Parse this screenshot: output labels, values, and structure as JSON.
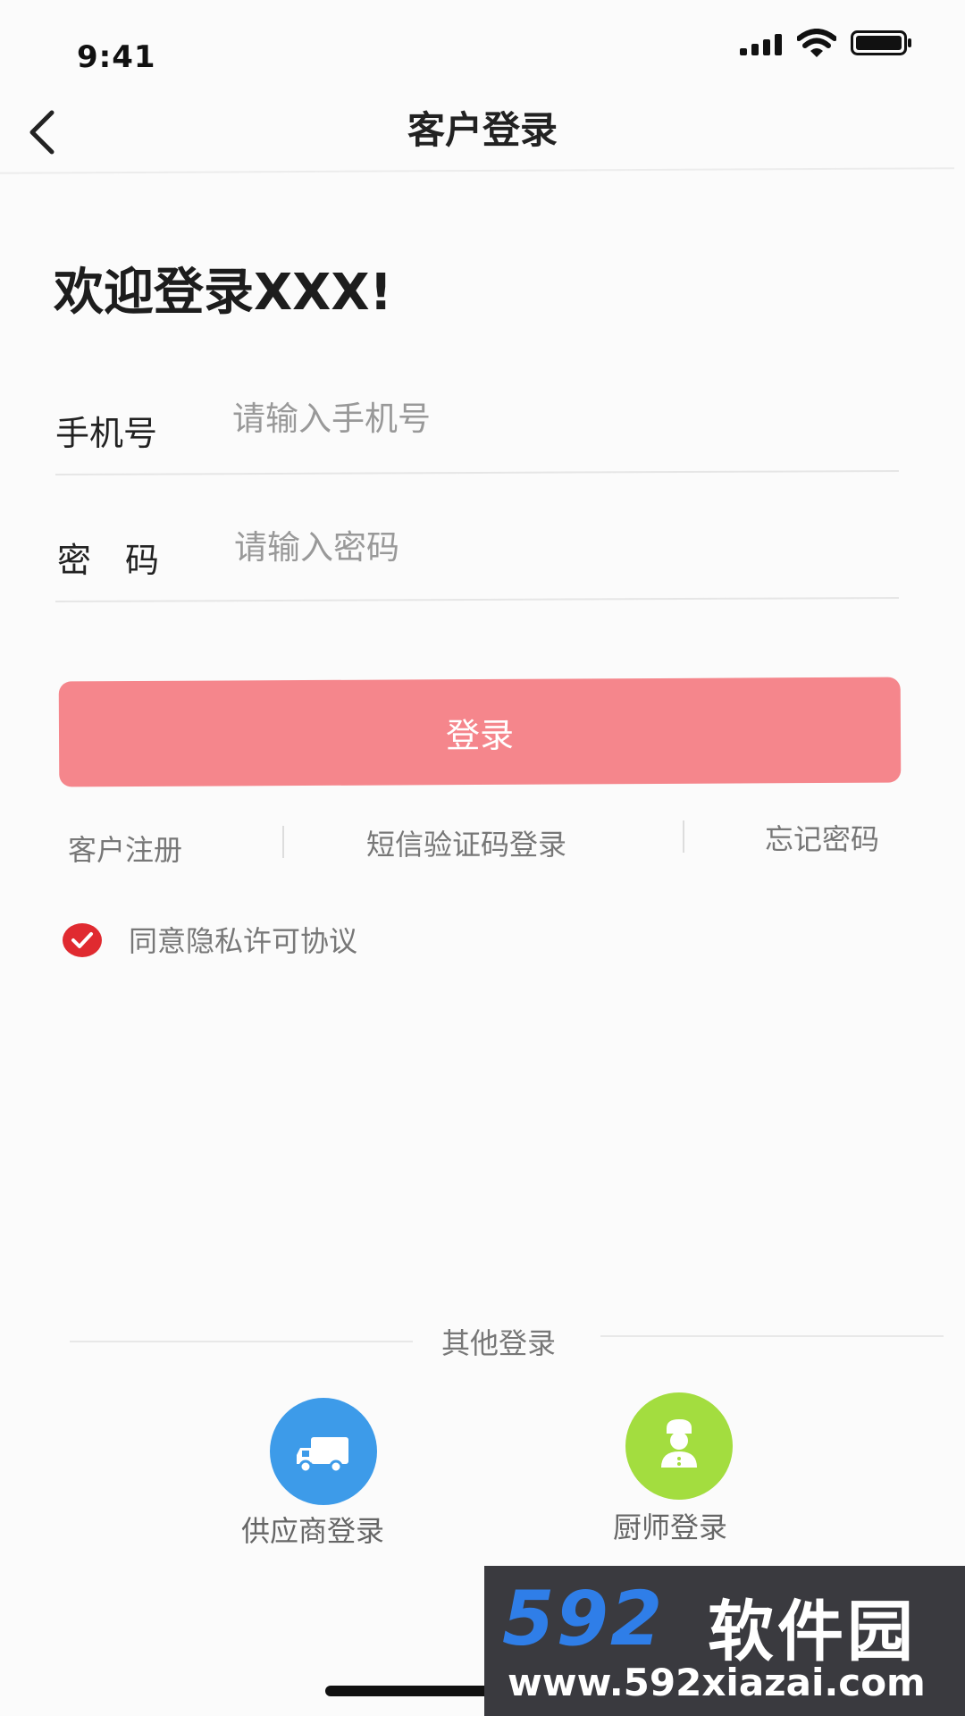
{
  "status_bar": {
    "time": "9:41"
  },
  "nav": {
    "title": "客户登录"
  },
  "welcome": "欢迎登录XXX!",
  "phone": {
    "label": "手机号",
    "placeholder": "请输入手机号"
  },
  "password": {
    "label": "密　码",
    "placeholder": "请输入密码"
  },
  "login_button": "登录",
  "links": {
    "register": "客户注册",
    "sms_login": "短信验证码登录",
    "forgot": "忘记密码"
  },
  "agreement": {
    "text": "同意隐私许可协议",
    "checked": true
  },
  "other_login": {
    "title": "其他登录",
    "options": [
      {
        "label": "供应商登录",
        "icon": "truck-icon",
        "color": "#3d9be9"
      },
      {
        "label": "厨师登录",
        "icon": "chef-icon",
        "color": "#a3dd3f"
      }
    ]
  },
  "watermark": {
    "brand_number": "592",
    "brand_cn": "软件园",
    "url": "www.592xiazai.com"
  },
  "colors": {
    "accent": "#f5868c",
    "check": "#e02a30"
  }
}
